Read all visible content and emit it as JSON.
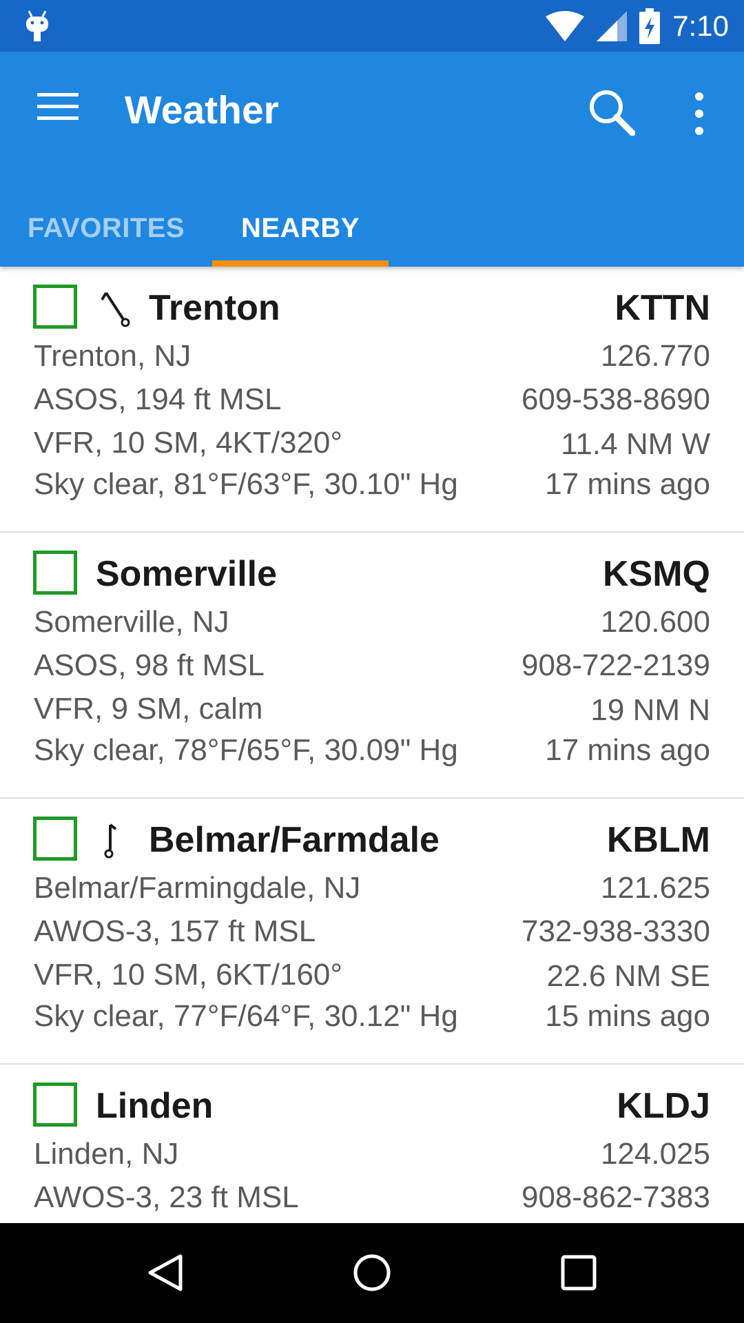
{
  "status_bar": {
    "time": "7:10"
  },
  "app_bar": {
    "title": "Weather",
    "tabs": [
      {
        "label": "FAVORITES",
        "selected": false
      },
      {
        "label": "NEARBY",
        "selected": true
      }
    ]
  },
  "stations": [
    {
      "name": "Trenton",
      "code": "KTTN",
      "has_wind": true,
      "location": "Trenton, NJ",
      "freq": "126.770",
      "type": "ASOS, 194 ft MSL",
      "phone": "609-538-8690",
      "conditions": "VFR, 10 SM, 4KT/320°",
      "distance": "11.4 NM W",
      "sky": "Sky clear, 81°F/63°F, 30.10\" Hg",
      "age": "17 mins ago"
    },
    {
      "name": "Somerville",
      "code": "KSMQ",
      "has_wind": false,
      "location": "Somerville, NJ",
      "freq": "120.600",
      "type": "ASOS, 98 ft MSL",
      "phone": "908-722-2139",
      "conditions": "VFR, 9 SM, calm",
      "distance": "19 NM N",
      "sky": "Sky clear, 78°F/65°F, 30.09\" Hg",
      "age": "17 mins ago"
    },
    {
      "name": "Belmar/Farmdale",
      "code": "KBLM",
      "has_wind": true,
      "location": "Belmar/Farmingdale, NJ",
      "freq": "121.625",
      "type": "AWOS-3, 157 ft MSL",
      "phone": "732-938-3330",
      "conditions": "VFR, 10 SM, 6KT/160°",
      "distance": "22.6 NM SE",
      "sky": "Sky clear, 77°F/64°F, 30.12\" Hg",
      "age": "15 mins ago"
    },
    {
      "name": "Linden",
      "code": "KLDJ",
      "has_wind": false,
      "location": "Linden, NJ",
      "freq": "124.025",
      "type": "AWOS-3, 23 ft MSL",
      "phone": "908-862-7383"
    }
  ],
  "colors": {
    "status_bar": "#1767c6",
    "app_bar": "#1f87e0",
    "tab_indicator": "#ff8f00",
    "checkbox": "#1e9a25"
  }
}
